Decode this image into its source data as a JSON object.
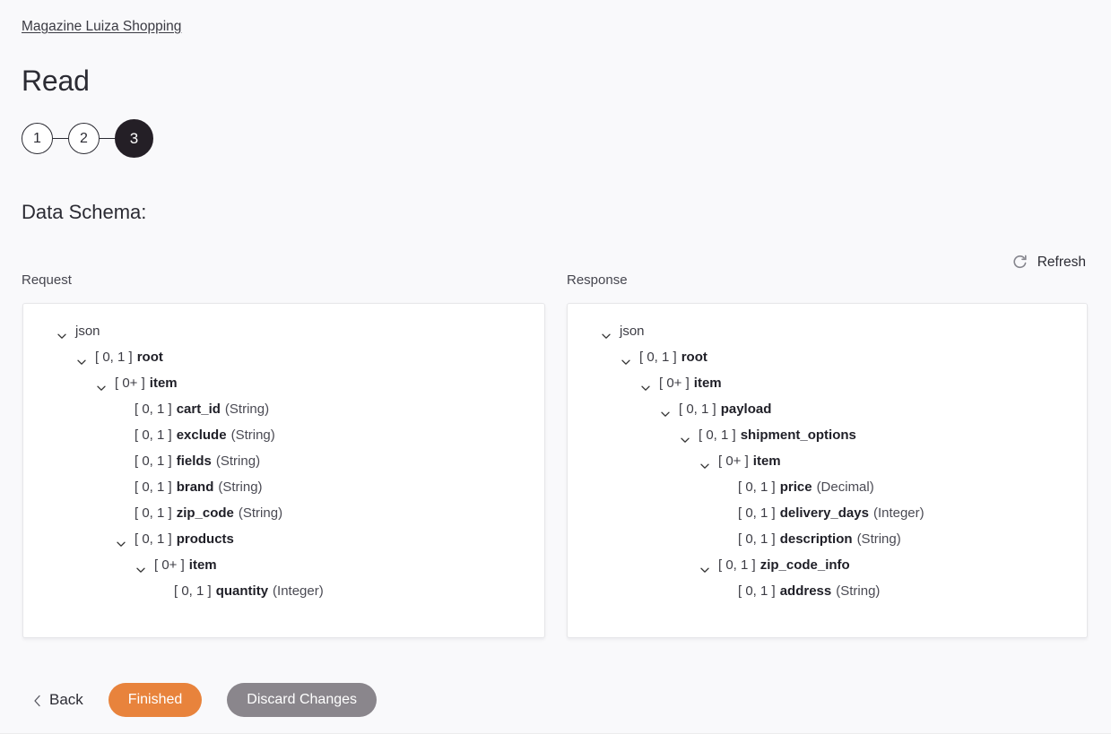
{
  "breadcrumb": {
    "label": "Magazine Luiza Shopping"
  },
  "header": {
    "title": "Read"
  },
  "stepper": {
    "steps": [
      {
        "label": "1",
        "active": false
      },
      {
        "label": "2",
        "active": false
      },
      {
        "label": "3",
        "active": true
      }
    ]
  },
  "section": {
    "title": "Data Schema:"
  },
  "toolbar": {
    "refresh_label": "Refresh",
    "refresh_icon": "refresh-icon"
  },
  "panels": {
    "request": {
      "label": "Request",
      "rows": [
        {
          "depth": 0,
          "toggle": true,
          "card": "",
          "name": "json",
          "type": "",
          "root": true
        },
        {
          "depth": 1,
          "toggle": true,
          "card": "[ 0, 1 ]",
          "name": "root",
          "type": ""
        },
        {
          "depth": 2,
          "toggle": true,
          "card": "[ 0+ ]",
          "name": "item",
          "type": ""
        },
        {
          "depth": 3,
          "toggle": false,
          "card": "[ 0, 1 ]",
          "name": "cart_id",
          "type": "(String)"
        },
        {
          "depth": 3,
          "toggle": false,
          "card": "[ 0, 1 ]",
          "name": "exclude",
          "type": "(String)"
        },
        {
          "depth": 3,
          "toggle": false,
          "card": "[ 0, 1 ]",
          "name": "fields",
          "type": "(String)"
        },
        {
          "depth": 3,
          "toggle": false,
          "card": "[ 0, 1 ]",
          "name": "brand",
          "type": "(String)"
        },
        {
          "depth": 3,
          "toggle": false,
          "card": "[ 0, 1 ]",
          "name": "zip_code",
          "type": "(String)"
        },
        {
          "depth": 3,
          "toggle": true,
          "card": "[ 0, 1 ]",
          "name": "products",
          "type": ""
        },
        {
          "depth": 4,
          "toggle": true,
          "card": "[ 0+ ]",
          "name": "item",
          "type": ""
        },
        {
          "depth": 5,
          "toggle": false,
          "card": "[ 0, 1 ]",
          "name": "quantity",
          "type": "(Integer)"
        }
      ]
    },
    "response": {
      "label": "Response",
      "rows": [
        {
          "depth": 0,
          "toggle": true,
          "card": "",
          "name": "json",
          "type": "",
          "root": true
        },
        {
          "depth": 1,
          "toggle": true,
          "card": "[ 0, 1 ]",
          "name": "root",
          "type": ""
        },
        {
          "depth": 2,
          "toggle": true,
          "card": "[ 0+ ]",
          "name": "item",
          "type": ""
        },
        {
          "depth": 3,
          "toggle": true,
          "card": "[ 0, 1 ]",
          "name": "payload",
          "type": ""
        },
        {
          "depth": 4,
          "toggle": true,
          "card": "[ 0, 1 ]",
          "name": "shipment_options",
          "type": ""
        },
        {
          "depth": 5,
          "toggle": true,
          "card": "[ 0+ ]",
          "name": "item",
          "type": ""
        },
        {
          "depth": 6,
          "toggle": false,
          "card": "[ 0, 1 ]",
          "name": "price",
          "type": "(Decimal)"
        },
        {
          "depth": 6,
          "toggle": false,
          "card": "[ 0, 1 ]",
          "name": "delivery_days",
          "type": "(Integer)"
        },
        {
          "depth": 6,
          "toggle": false,
          "card": "[ 0, 1 ]",
          "name": "description",
          "type": "(String)"
        },
        {
          "depth": 5,
          "toggle": true,
          "card": "[ 0, 1 ]",
          "name": "zip_code_info",
          "type": ""
        },
        {
          "depth": 6,
          "toggle": false,
          "card": "[ 0, 1 ]",
          "name": "address",
          "type": "(String)"
        }
      ]
    }
  },
  "footer": {
    "back_label": "Back",
    "finished_label": "Finished",
    "discard_label": "Discard Changes"
  },
  "colors": {
    "primary": "#e8833c",
    "secondary": "#8a868c",
    "active_step": "#241f26",
    "page_background": "#f9f9fb",
    "panel_background": "#ffffff"
  }
}
